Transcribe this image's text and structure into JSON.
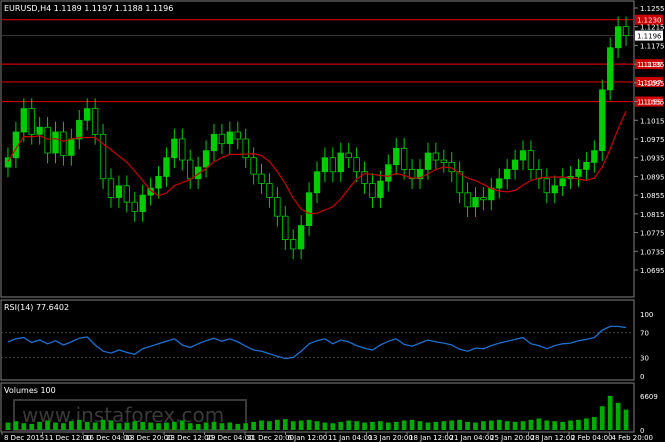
{
  "window": {
    "title": "EURUSD,H4  1.1189 1.1197 1.1188 1.1196"
  },
  "main_axis": {
    "ticks": [
      "1.1255",
      "1.1215",
      "1.1175",
      "1.1135",
      "1.1095",
      "1.1055",
      "1.1015",
      "1.0975",
      "1.0935",
      "1.0895",
      "1.0855",
      "1.0815",
      "1.0775",
      "1.0735",
      "1.0695"
    ],
    "current_price": "1.1196",
    "level_tags": [
      "1.1230",
      "1.1135",
      "1.1097",
      "1.1055"
    ]
  },
  "rsi_panel": {
    "label": "RSI(14) 77.6402",
    "ticks": [
      "100",
      "70",
      "30",
      "0"
    ]
  },
  "volume_panel": {
    "label": "Volumes 100",
    "ticks": [
      "6609",
      "0"
    ]
  },
  "x_axis": {
    "ticks": [
      "8 Dec 2015",
      "11 Dec 12:00",
      "16 Dec 04:00",
      "18 Dec 20:00",
      "23 Dec 12:00",
      "29 Dec 04:00",
      "31 Dec 20:00",
      "6 Jan 12:00",
      "11 Jan 04:00",
      "13 Jan 20:00",
      "18 Jan 12:00",
      "21 Jan 04:00",
      "25 Jan 20:00",
      "28 Jan 12:00",
      "2 Feb 04:00",
      "4 Feb 20:00"
    ]
  },
  "watermark": "www.instaforex.com",
  "colors": {
    "background": "#000000",
    "candle": "#00cc00",
    "ma": "#cc0000",
    "level_line": "#cc0000",
    "rsi": "#1e6fd0",
    "volume": "#00aa00",
    "axis": "#808080"
  },
  "chart_data": {
    "type": "candlestick",
    "symbol": "EURUSD",
    "timeframe": "H4",
    "ohlc_last": {
      "open": 1.1189,
      "high": 1.1197,
      "low": 1.1188,
      "close": 1.1196
    },
    "ylim": [
      1.0695,
      1.1255
    ],
    "levels": [
      1.123,
      1.1135,
      1.1097,
      1.1055
    ],
    "closes": [
      1.0935,
      1.099,
      1.104,
      1.0985,
      1.1,
      1.0945,
      1.099,
      1.094,
      1.0975,
      1.1015,
      1.104,
      1.0985,
      1.089,
      1.085,
      1.0875,
      1.084,
      1.082,
      1.0855,
      1.087,
      1.0895,
      1.0935,
      1.0975,
      1.093,
      1.089,
      1.0915,
      1.095,
      1.0985,
      1.0965,
      1.099,
      1.0975,
      1.0935,
      1.09,
      1.088,
      1.085,
      1.081,
      1.076,
      1.074,
      1.079,
      1.086,
      1.0905,
      1.0935,
      1.0905,
      1.0945,
      1.0935,
      1.0905,
      1.088,
      1.085,
      1.0885,
      1.092,
      1.0955,
      1.091,
      1.089,
      1.091,
      1.0945,
      1.093,
      1.0925,
      1.0905,
      1.086,
      1.083,
      1.085,
      1.0845,
      1.087,
      1.089,
      1.091,
      1.093,
      1.095,
      1.091,
      1.089,
      1.086,
      1.0875,
      1.089,
      1.0895,
      1.091,
      1.0925,
      1.095,
      1.108,
      1.117,
      1.1215,
      1.1196
    ],
    "rsi": [
      55,
      60,
      62,
      54,
      58,
      52,
      57,
      50,
      55,
      61,
      63,
      50,
      40,
      37,
      42,
      38,
      35,
      44,
      48,
      52,
      56,
      60,
      50,
      46,
      52,
      57,
      61,
      56,
      60,
      55,
      48,
      42,
      40,
      36,
      32,
      28,
      30,
      40,
      52,
      57,
      60,
      52,
      58,
      55,
      49,
      45,
      42,
      50,
      56,
      60,
      51,
      48,
      53,
      58,
      55,
      53,
      50,
      43,
      40,
      45,
      44,
      49,
      53,
      56,
      59,
      62,
      52,
      49,
      44,
      49,
      52,
      53,
      57,
      59,
      62,
      74,
      80,
      80,
      78
    ],
    "volumes": [
      22,
      26,
      20,
      18,
      24,
      28,
      22,
      20,
      26,
      30,
      24,
      22,
      30,
      28,
      20,
      22,
      26,
      24,
      22,
      20,
      22,
      24,
      28,
      20,
      18,
      22,
      24,
      20,
      22,
      18,
      20,
      24,
      28,
      26,
      30,
      32,
      26,
      28,
      30,
      26,
      22,
      20,
      24,
      28,
      26,
      22,
      24,
      26,
      22,
      24,
      28,
      30,
      26,
      22,
      24,
      26,
      28,
      30,
      24,
      22,
      26,
      28,
      30,
      26,
      24,
      26,
      30,
      34,
      28,
      26,
      24,
      28,
      30,
      34,
      38,
      70,
      100,
      80,
      60
    ]
  }
}
